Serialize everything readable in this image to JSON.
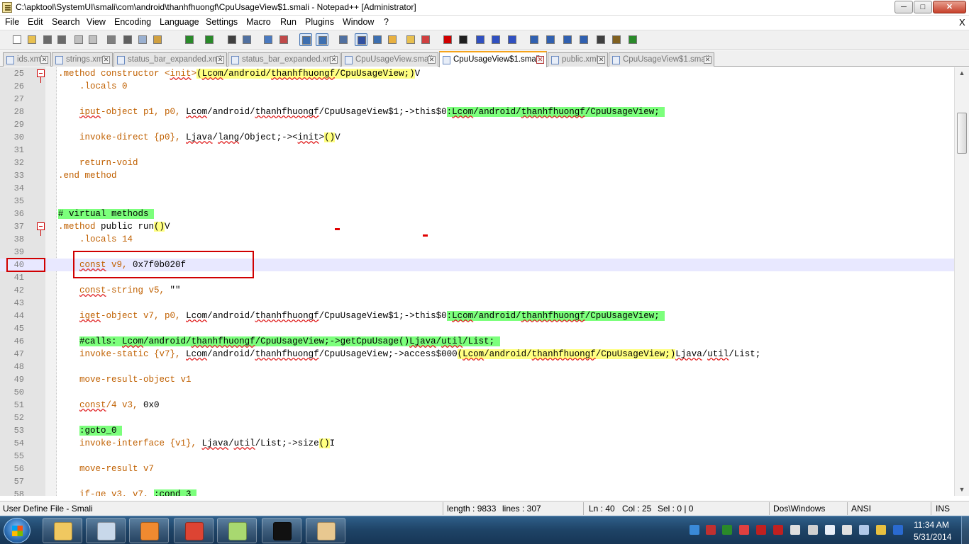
{
  "window": {
    "title": "C:\\apktool\\SystemUI\\smali\\com\\android\\thanhfhuongf\\CpuUsageView$1.smali - Notepad++ [Administrator]",
    "min_glyph": "─",
    "max_glyph": "□",
    "close_glyph": "✕"
  },
  "menu": {
    "items": [
      "File",
      "Edit",
      "Search",
      "View",
      "Encoding",
      "Language",
      "Settings",
      "Macro",
      "Run",
      "Plugins",
      "Window",
      "?"
    ],
    "close_glyph": "X"
  },
  "toolbar": {
    "buttons": [
      {
        "icon": "new-file-icon",
        "color": "#ffffff"
      },
      {
        "icon": "open-file-icon",
        "color": "#e8c050"
      },
      {
        "icon": "save-icon",
        "color": "#6a6a6a"
      },
      {
        "icon": "save-all-icon",
        "color": "#6a6a6a"
      },
      {
        "icon": "close-file-icon",
        "color": "#c0c0c0"
      },
      {
        "icon": "close-all-icon",
        "color": "#c0c0c0"
      },
      {
        "icon": "print-icon",
        "color": "#808080"
      },
      {
        "icon": "cut-icon",
        "color": "#606060"
      },
      {
        "icon": "copy-icon",
        "color": "#9ab0d0"
      },
      {
        "icon": "paste-icon",
        "color": "#d0a040"
      },
      {
        "icon": "undo-icon",
        "color": "#2a8a2a"
      },
      {
        "icon": "redo-icon",
        "color": "#2a8a2a"
      },
      {
        "icon": "find-icon",
        "color": "#404040"
      },
      {
        "icon": "replace-icon",
        "color": "#5070a0"
      },
      {
        "icon": "zoom-in-icon",
        "color": "#4a7ac0"
      },
      {
        "icon": "zoom-out-icon",
        "color": "#c04a4a"
      },
      {
        "icon": "sync-vertical-icon",
        "color": "#3d6fb0"
      },
      {
        "icon": "sync-horizontal-icon",
        "color": "#3d6fb0"
      },
      {
        "icon": "word-wrap-icon",
        "color": "#5070a0"
      },
      {
        "icon": "show-all-chars-icon",
        "color": "#3050a0"
      },
      {
        "icon": "indent-guide-icon",
        "color": "#3d6fb0"
      },
      {
        "icon": "user-language-icon",
        "color": "#e8b040"
      },
      {
        "icon": "doc-map-icon",
        "color": "#e8c050"
      },
      {
        "icon": "function-list-icon",
        "color": "#d04040"
      },
      {
        "icon": "record-macro-icon",
        "color": "#d00000"
      },
      {
        "icon": "stop-record-icon",
        "color": "#202020"
      },
      {
        "icon": "playback-icon",
        "color": "#3050c0"
      },
      {
        "icon": "run-macro-multiple-icon",
        "color": "#3050c0"
      },
      {
        "icon": "save-macro-icon",
        "color": "#3050c0"
      },
      {
        "icon": "fold-icon",
        "color": "#3060b0"
      },
      {
        "icon": "up-arrow-icon",
        "color": "#3060b0"
      },
      {
        "icon": "down-arrow-icon",
        "color": "#3060b0"
      },
      {
        "icon": "unfold-icon",
        "color": "#3060b0"
      },
      {
        "icon": "spell-check-icon",
        "color": "#404040"
      },
      {
        "icon": "spell-settings-icon",
        "color": "#806020"
      },
      {
        "icon": "spell-auto-icon",
        "color": "#2a8a2a"
      }
    ]
  },
  "tabs": [
    {
      "label": "ids.xml",
      "close": "✕"
    },
    {
      "label": "strings.xml",
      "close": "✕"
    },
    {
      "label": "status_bar_expanded.xml",
      "close": "✕"
    },
    {
      "label": "status_bar_expanded.xml",
      "close": "✕"
    },
    {
      "label": "CpuUsageView.smali",
      "close": "✕"
    },
    {
      "label": "CpuUsageView$1.smali",
      "close": "✕"
    },
    {
      "label": "public.xml",
      "close": "✕"
    },
    {
      "label": "CpuUsageView$1.smali",
      "close": "✕"
    }
  ],
  "editor": {
    "lines": [
      {
        "n": "25",
        "segs": [
          {
            "t": ".method ",
            "c": "kw"
          },
          {
            "t": "constructor <",
            "c": "kw"
          },
          {
            "t": "init",
            "c": "kwsq"
          },
          {
            "t": ">",
            "c": "kw"
          },
          {
            "t": "(",
            "c": "yl"
          },
          {
            "t": "Lcom",
            "c": "yls"
          },
          {
            "t": "/android/",
            "c": "yl"
          },
          {
            "t": "thanhfhuongf",
            "c": "yls"
          },
          {
            "t": "/CpuUsageView;)",
            "c": "yl"
          },
          {
            "t": "V",
            "c": "pl"
          }
        ]
      },
      {
        "n": "26",
        "segs": [
          {
            "t": "    .locals ",
            "c": "kw"
          },
          {
            "t": "0",
            "c": "num"
          }
        ]
      },
      {
        "n": "27",
        "segs": []
      },
      {
        "n": "28",
        "segs": [
          {
            "t": "    ",
            "c": "pl"
          },
          {
            "t": "iput",
            "c": "kwsq"
          },
          {
            "t": "-object p1, p0, ",
            "c": "kw"
          },
          {
            "t": "Lcom",
            "c": "sq"
          },
          {
            "t": "/android/",
            "c": "pl"
          },
          {
            "t": "thanhfhuongf",
            "c": "sq"
          },
          {
            "t": "/CpuUsageView$1;->this$0",
            "c": "pl"
          },
          {
            "t": ":",
            "c": "gl"
          },
          {
            "t": "Lcom",
            "c": "gls"
          },
          {
            "t": "/android/",
            "c": "gl"
          },
          {
            "t": "thanhfhuongf",
            "c": "gls"
          },
          {
            "t": "/CpuUsageView; ",
            "c": "gl"
          }
        ]
      },
      {
        "n": "29",
        "segs": []
      },
      {
        "n": "30",
        "segs": [
          {
            "t": "    invoke-direct {p0}, ",
            "c": "kw"
          },
          {
            "t": "Ljava",
            "c": "sq"
          },
          {
            "t": "/",
            "c": "pl"
          },
          {
            "t": "lang",
            "c": "sq"
          },
          {
            "t": "/Object;-><",
            "c": "pl"
          },
          {
            "t": "init",
            "c": "sq"
          },
          {
            "t": ">",
            "c": "pl"
          },
          {
            "t": "()",
            "c": "yl"
          },
          {
            "t": "V",
            "c": "pl"
          }
        ]
      },
      {
        "n": "31",
        "segs": []
      },
      {
        "n": "32",
        "segs": [
          {
            "t": "    return-void",
            "c": "kw"
          }
        ]
      },
      {
        "n": "33",
        "segs": [
          {
            "t": ".end ",
            "c": "kw"
          },
          {
            "t": "method",
            "c": "kw"
          }
        ]
      },
      {
        "n": "34",
        "segs": []
      },
      {
        "n": "35",
        "segs": []
      },
      {
        "n": "36",
        "segs": [
          {
            "t": "# virtual methods ",
            "c": "gl"
          }
        ]
      },
      {
        "n": "37",
        "segs": [
          {
            "t": ".method ",
            "c": "kw"
          },
          {
            "t": "public run",
            "c": "pl"
          },
          {
            "t": "()",
            "c": "yl"
          },
          {
            "t": "V",
            "c": "pl"
          }
        ]
      },
      {
        "n": "38",
        "segs": [
          {
            "t": "    .locals ",
            "c": "kw"
          },
          {
            "t": "14",
            "c": "num"
          }
        ]
      },
      {
        "n": "39",
        "segs": []
      },
      {
        "n": "40",
        "segs": [
          {
            "t": "    ",
            "c": "pl"
          },
          {
            "t": "const",
            "c": "kwsq"
          },
          {
            "t": " v9, ",
            "c": "kw"
          },
          {
            "t": "0x7f0b020f",
            "c": "pl"
          }
        ]
      },
      {
        "n": "41",
        "segs": []
      },
      {
        "n": "42",
        "segs": [
          {
            "t": "    ",
            "c": "pl"
          },
          {
            "t": "const",
            "c": "kwsq"
          },
          {
            "t": "-string v5, ",
            "c": "kw"
          },
          {
            "t": "\"\"",
            "c": "pl"
          }
        ]
      },
      {
        "n": "43",
        "segs": []
      },
      {
        "n": "44",
        "segs": [
          {
            "t": "    ",
            "c": "pl"
          },
          {
            "t": "iget",
            "c": "kwsq"
          },
          {
            "t": "-object v7, p0, ",
            "c": "kw"
          },
          {
            "t": "Lcom",
            "c": "sq"
          },
          {
            "t": "/android/",
            "c": "pl"
          },
          {
            "t": "thanhfhuongf",
            "c": "sq"
          },
          {
            "t": "/CpuUsageView$1;->this$0",
            "c": "pl"
          },
          {
            "t": ":",
            "c": "gl"
          },
          {
            "t": "Lcom",
            "c": "gls"
          },
          {
            "t": "/android/",
            "c": "gl"
          },
          {
            "t": "thanhfhuongf",
            "c": "gls"
          },
          {
            "t": "/CpuUsageView; ",
            "c": "gl"
          }
        ]
      },
      {
        "n": "45",
        "segs": []
      },
      {
        "n": "46",
        "segs": [
          {
            "t": "    ",
            "c": "pl"
          },
          {
            "t": "#calls: ",
            "c": "gl"
          },
          {
            "t": "Lcom",
            "c": "gls"
          },
          {
            "t": "/android/",
            "c": "gl"
          },
          {
            "t": "thanhfhuongf",
            "c": "gls"
          },
          {
            "t": "/CpuUsageView;->getCpuUsage()",
            "c": "gl"
          },
          {
            "t": "Ljava",
            "c": "gls"
          },
          {
            "t": "/",
            "c": "gl"
          },
          {
            "t": "util",
            "c": "gls"
          },
          {
            "t": "/List; ",
            "c": "gl"
          }
        ]
      },
      {
        "n": "47",
        "segs": [
          {
            "t": "    invoke-static {v7}, ",
            "c": "kw"
          },
          {
            "t": "Lcom",
            "c": "sq"
          },
          {
            "t": "/android/",
            "c": "pl"
          },
          {
            "t": "thanhfhuongf",
            "c": "sq"
          },
          {
            "t": "/CpuUsageView;->access$000",
            "c": "pl"
          },
          {
            "t": "(",
            "c": "yl"
          },
          {
            "t": "Lcom",
            "c": "yls"
          },
          {
            "t": "/android/",
            "c": "yl"
          },
          {
            "t": "thanhfhuongf",
            "c": "yls"
          },
          {
            "t": "/CpuUsageView;)",
            "c": "yl"
          },
          {
            "t": "Ljava",
            "c": "sq"
          },
          {
            "t": "/",
            "c": "pl"
          },
          {
            "t": "util",
            "c": "sq"
          },
          {
            "t": "/List;",
            "c": "pl"
          }
        ]
      },
      {
        "n": "48",
        "segs": []
      },
      {
        "n": "49",
        "segs": [
          {
            "t": "    move-result-object v1",
            "c": "kw"
          }
        ]
      },
      {
        "n": "50",
        "segs": []
      },
      {
        "n": "51",
        "segs": [
          {
            "t": "    ",
            "c": "pl"
          },
          {
            "t": "const",
            "c": "kwsq"
          },
          {
            "t": "/4 v3, ",
            "c": "kw"
          },
          {
            "t": "0x0",
            "c": "pl"
          }
        ]
      },
      {
        "n": "52",
        "segs": []
      },
      {
        "n": "53",
        "segs": [
          {
            "t": "    ",
            "c": "pl"
          },
          {
            "t": ":goto_0 ",
            "c": "gl"
          }
        ]
      },
      {
        "n": "54",
        "segs": [
          {
            "t": "    invoke-interface {v1}, ",
            "c": "kw"
          },
          {
            "t": "Ljava",
            "c": "sq"
          },
          {
            "t": "/",
            "c": "pl"
          },
          {
            "t": "util",
            "c": "sq"
          },
          {
            "t": "/List;->size",
            "c": "pl"
          },
          {
            "t": "()",
            "c": "yl"
          },
          {
            "t": "I",
            "c": "pl"
          }
        ]
      },
      {
        "n": "55",
        "segs": []
      },
      {
        "n": "56",
        "segs": [
          {
            "t": "    move-result v7",
            "c": "kw"
          }
        ]
      },
      {
        "n": "57",
        "segs": []
      },
      {
        "n": "58",
        "segs": [
          {
            "t": "    if-ge v3, v7, ",
            "c": "kw"
          },
          {
            "t": ":cond_3 ",
            "c": "gl"
          }
        ]
      }
    ]
  },
  "scrollbar": {
    "up": "▲",
    "down": "▼"
  },
  "status": {
    "lang": "User Define File - Smali",
    "length": "length : 9833",
    "lines": "lines : 307",
    "ln": "Ln : 40",
    "col": "Col : 25",
    "sel": "Sel : 0 | 0",
    "eol": "Dos\\Windows",
    "enc": "ANSI",
    "mode": "INS"
  },
  "taskbar": {
    "items": [
      {
        "icon": "explorer-icon",
        "color": "#f0c860"
      },
      {
        "icon": "calculator-icon",
        "color": "#c8d8ea"
      },
      {
        "icon": "media-player-icon",
        "color": "#f08a30"
      },
      {
        "icon": "chrome-icon",
        "color": "#dd4433"
      },
      {
        "icon": "notepadpp-icon",
        "color": "#a8d870"
      },
      {
        "icon": "cmd-icon",
        "color": "#111111"
      },
      {
        "icon": "paint-icon",
        "color": "#e8c890"
      }
    ],
    "tray": [
      {
        "icon": "dropbox-icon",
        "color": "#3a8ad8"
      },
      {
        "icon": "security-icon",
        "color": "#c03030"
      },
      {
        "icon": "network-monitor-icon",
        "color": "#2a8a2a"
      },
      {
        "icon": "flag-icon",
        "color": "#e04040"
      },
      {
        "icon": "shield-icon",
        "color": "#c02020"
      },
      {
        "icon": "shield-alert-icon",
        "color": "#c02020"
      },
      {
        "icon": "usb-icon",
        "color": "#e0e0e0"
      },
      {
        "icon": "signal-icon",
        "color": "#d0d0d0"
      },
      {
        "icon": "bluetooth-icon",
        "color": "#e8eef8"
      },
      {
        "icon": "volume-icon",
        "color": "#e0e0e0"
      },
      {
        "icon": "display-icon",
        "color": "#b0c8e8"
      },
      {
        "icon": "tools-icon",
        "color": "#e8c040"
      },
      {
        "icon": "antivirus-icon",
        "color": "#2a6ad0"
      }
    ],
    "time": "11:34 AM",
    "date": "5/31/2014"
  }
}
